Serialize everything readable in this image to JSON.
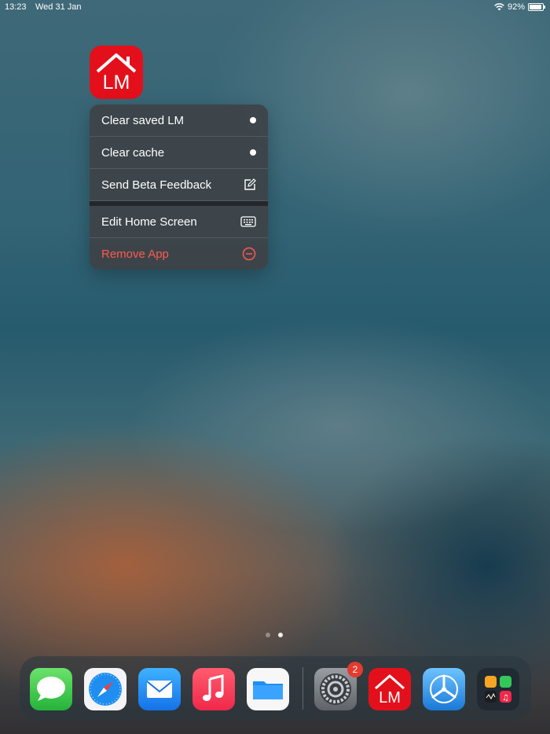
{
  "status_bar": {
    "time": "13:23",
    "date": "Wed 31 Jan",
    "battery": "92%"
  },
  "app": {
    "name": "LM"
  },
  "menu": {
    "items": [
      {
        "label": "Clear saved LM"
      },
      {
        "label": "Clear cache"
      },
      {
        "label": "Send Beta Feedback"
      },
      {
        "label": "Edit Home Screen"
      },
      {
        "label": "Remove App"
      }
    ]
  },
  "dock": {
    "apps": [
      {
        "name": "Messages",
        "icon": "messages-icon"
      },
      {
        "name": "Safari",
        "icon": "safari-icon"
      },
      {
        "name": "Mail",
        "icon": "mail-icon"
      },
      {
        "name": "Music",
        "icon": "music-icon"
      },
      {
        "name": "Files",
        "icon": "files-icon"
      },
      {
        "name": "Settings",
        "icon": "settings-icon"
      },
      {
        "name": "LM",
        "icon": "lm-icon"
      },
      {
        "name": "TestFlight",
        "icon": "testflight-icon"
      },
      {
        "name": "Recent apps",
        "icon": "app-folder-icon"
      }
    ],
    "settings_badge": "2"
  },
  "colors": {
    "accent_red": "#e3101b",
    "danger": "#ff5a4d"
  }
}
